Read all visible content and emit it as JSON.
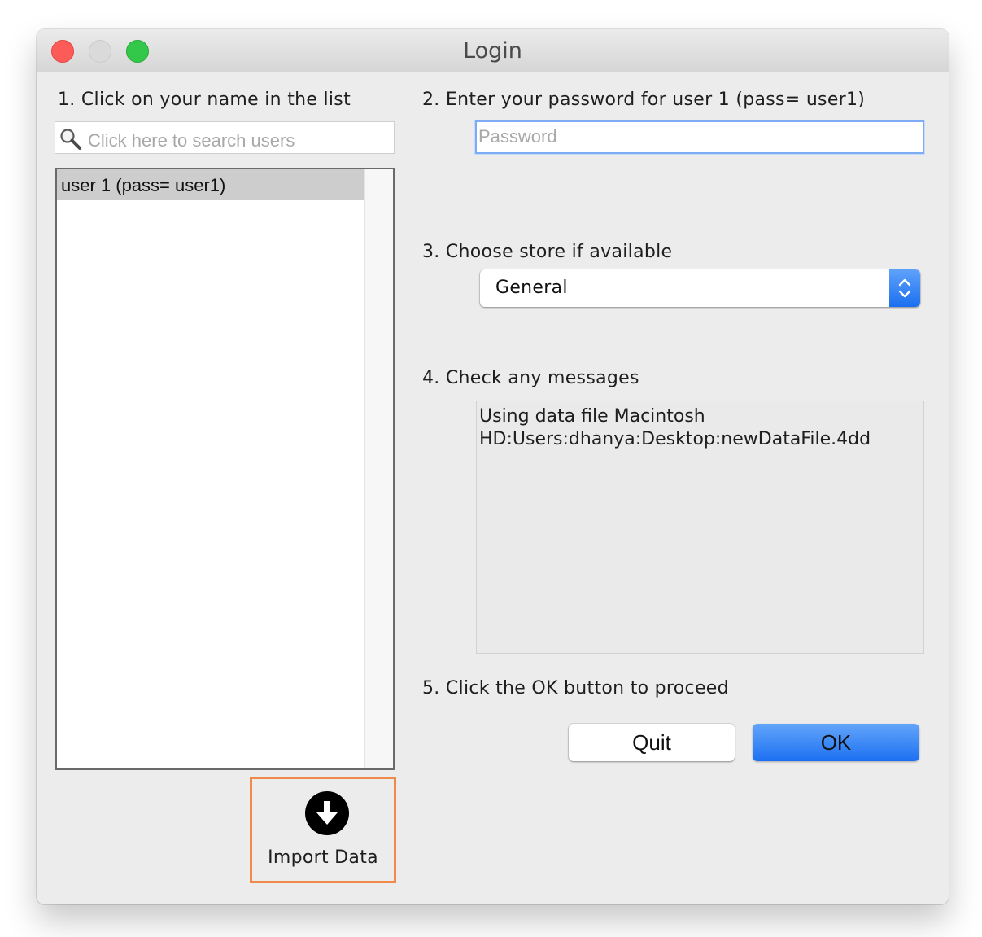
{
  "window": {
    "title": "Login"
  },
  "steps": {
    "step1": "1. Click on your name in the list",
    "step2": "2. Enter your password for user 1 (pass= user1)",
    "step3": "3. Choose store if available",
    "step4": "4. Check any messages",
    "step5": "5. Click the OK button to proceed"
  },
  "search": {
    "icon": "search-icon",
    "placeholder": "Click here to search users",
    "value": ""
  },
  "users": {
    "items": [
      {
        "label": "user 1 (pass= user1)",
        "selected": true
      }
    ]
  },
  "import": {
    "icon": "download-circle-icon",
    "label": "Import Data",
    "highlight_color": "#f08a4b"
  },
  "password": {
    "placeholder": "Password",
    "value": ""
  },
  "store": {
    "selected": "General"
  },
  "messages": {
    "text": "Using data file Macintosh\nHD:Users:dhanya:Desktop:newDataFile.4dd"
  },
  "buttons": {
    "quit_label": "Quit",
    "ok_label": "OK"
  },
  "colors": {
    "accent": "#1c70f1",
    "close": "#fc5b57",
    "maximize": "#34c84a"
  }
}
